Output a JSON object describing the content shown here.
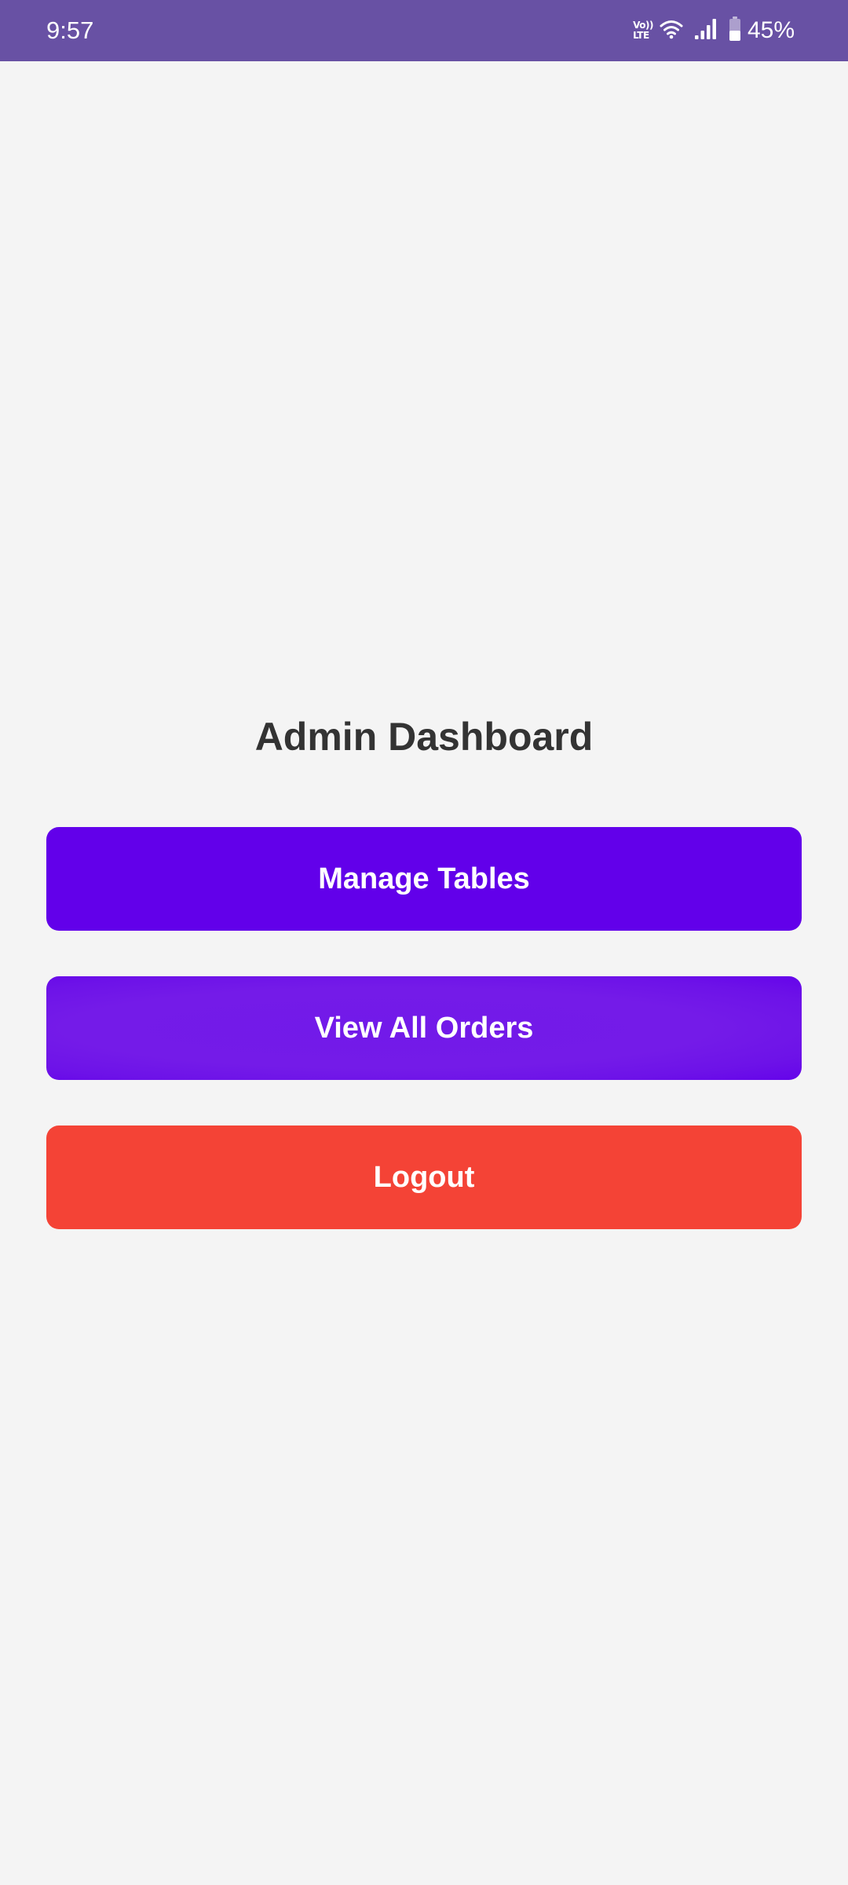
{
  "status_bar": {
    "time": "9:57",
    "volte_top": "Vo))",
    "volte_bottom": "LTE",
    "battery_percent": "45%",
    "battery_level": 0.45,
    "icons": [
      "volte-icon",
      "wifi-icon",
      "signal-icon",
      "battery-icon"
    ],
    "background_color": "#6851a4"
  },
  "main": {
    "title": "Admin Dashboard",
    "buttons": [
      {
        "label": "Manage Tables",
        "color": "#6200ea"
      },
      {
        "label": "View All Orders",
        "color": "#721ae9"
      },
      {
        "label": "Logout",
        "color": "#f44336"
      }
    ]
  }
}
